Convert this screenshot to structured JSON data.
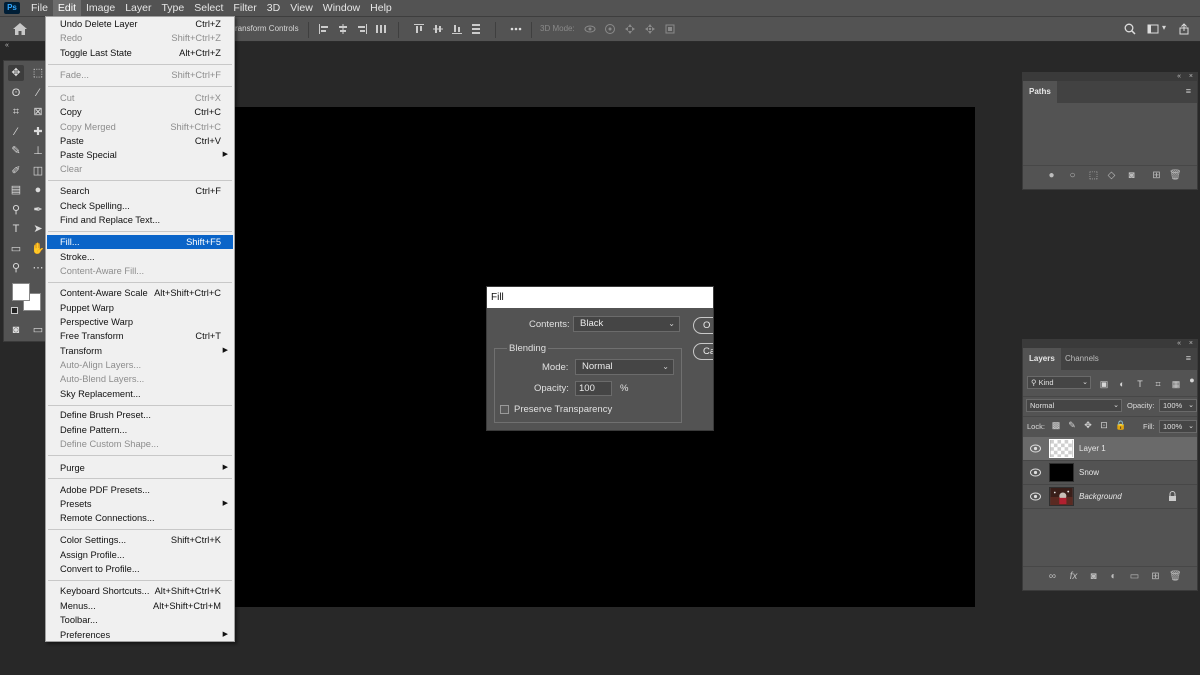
{
  "menubar": {
    "app_icon": "Ps",
    "items": [
      "File",
      "Edit",
      "Image",
      "Layer",
      "Type",
      "Select",
      "Filter",
      "3D",
      "View",
      "Window",
      "Help"
    ],
    "active": "Edit"
  },
  "options_bar": {
    "transform_controls_label": "ransform Controls",
    "mode_label": "3D Mode:",
    "icons": [
      "home-icon",
      "align-left-icon",
      "align-center-icon",
      "align-right-icon",
      "distribute-icon",
      "more-icon",
      "search-icon",
      "workspace-icon",
      "share-icon"
    ]
  },
  "edit_menu": {
    "items": [
      {
        "label": "Undo Delete Layer",
        "shortcut": "Ctrl+Z"
      },
      {
        "label": "Redo",
        "shortcut": "Shift+Ctrl+Z",
        "disabled": true
      },
      {
        "label": "Toggle Last State",
        "shortcut": "Alt+Ctrl+Z"
      },
      {
        "label": "Fade...",
        "shortcut": "Shift+Ctrl+F",
        "disabled": true
      },
      {
        "label": "Cut",
        "shortcut": "Ctrl+X",
        "disabled": true
      },
      {
        "label": "Copy",
        "shortcut": "Ctrl+C"
      },
      {
        "label": "Copy Merged",
        "shortcut": "Shift+Ctrl+C",
        "disabled": true
      },
      {
        "label": "Paste",
        "shortcut": "Ctrl+V"
      },
      {
        "label": "Paste Special",
        "submenu": true
      },
      {
        "label": "Clear",
        "disabled": true
      },
      {
        "label": "Search",
        "shortcut": "Ctrl+F"
      },
      {
        "label": "Check Spelling..."
      },
      {
        "label": "Find and Replace Text..."
      },
      {
        "label": "Fill...",
        "shortcut": "Shift+F5",
        "highlighted": true
      },
      {
        "label": "Stroke..."
      },
      {
        "label": "Content-Aware Fill...",
        "disabled": true
      },
      {
        "label": "Content-Aware Scale",
        "shortcut": "Alt+Shift+Ctrl+C"
      },
      {
        "label": "Puppet Warp"
      },
      {
        "label": "Perspective Warp"
      },
      {
        "label": "Free Transform",
        "shortcut": "Ctrl+T"
      },
      {
        "label": "Transform",
        "submenu": true
      },
      {
        "label": "Auto-Align Layers...",
        "disabled": true
      },
      {
        "label": "Auto-Blend Layers...",
        "disabled": true
      },
      {
        "label": "Sky Replacement..."
      },
      {
        "label": "Define Brush Preset..."
      },
      {
        "label": "Define Pattern..."
      },
      {
        "label": "Define Custom Shape...",
        "disabled": true
      },
      {
        "label": "Purge",
        "submenu": true
      },
      {
        "label": "Adobe PDF Presets..."
      },
      {
        "label": "Presets",
        "submenu": true
      },
      {
        "label": "Remote Connections..."
      },
      {
        "label": "Color Settings...",
        "shortcut": "Shift+Ctrl+K"
      },
      {
        "label": "Assign Profile..."
      },
      {
        "label": "Convert to Profile..."
      },
      {
        "label": "Keyboard Shortcuts...",
        "shortcut": "Alt+Shift+Ctrl+K"
      },
      {
        "label": "Menus...",
        "shortcut": "Alt+Shift+Ctrl+M"
      },
      {
        "label": "Toolbar..."
      },
      {
        "label": "Preferences",
        "submenu": true
      }
    ]
  },
  "fill_dialog": {
    "title": "Fill",
    "contents_label": "Contents:",
    "contents_value": "Black",
    "blending_label": "Blending",
    "mode_label": "Mode:",
    "mode_value": "Normal",
    "opacity_label": "Opacity:",
    "opacity_value": "100",
    "opacity_unit": "%",
    "preserve_label": "Preserve Transparency",
    "preserve_checked": false,
    "ok_label": "O",
    "cancel_label": "Can"
  },
  "paths_panel": {
    "tab": "Paths",
    "footer_icons": [
      "fill-path-icon",
      "stroke-path-icon",
      "load-selection-icon",
      "make-path-icon",
      "add-mask-icon",
      "new-path-icon",
      "delete-icon"
    ]
  },
  "layers_panel": {
    "tabs": [
      "Layers",
      "Channels"
    ],
    "active_tab": "Layers",
    "kind_label": "Kind",
    "blend_mode": "Normal",
    "opacity_label": "Opacity:",
    "opacity_value": "100%",
    "lock_label": "Lock:",
    "fill_label": "Fill:",
    "fill_value": "100%",
    "layers": [
      {
        "name": "Layer 1",
        "selected": true,
        "thumb": "transparent"
      },
      {
        "name": "Snow",
        "selected": false,
        "thumb": "black"
      },
      {
        "name": "Background",
        "selected": false,
        "thumb": "photo",
        "locked": true
      }
    ]
  },
  "colors": {
    "menu_highlight": "#0a64c8",
    "panel_bg": "#535353",
    "app_bg": "#282828",
    "canvas": "#000000"
  }
}
